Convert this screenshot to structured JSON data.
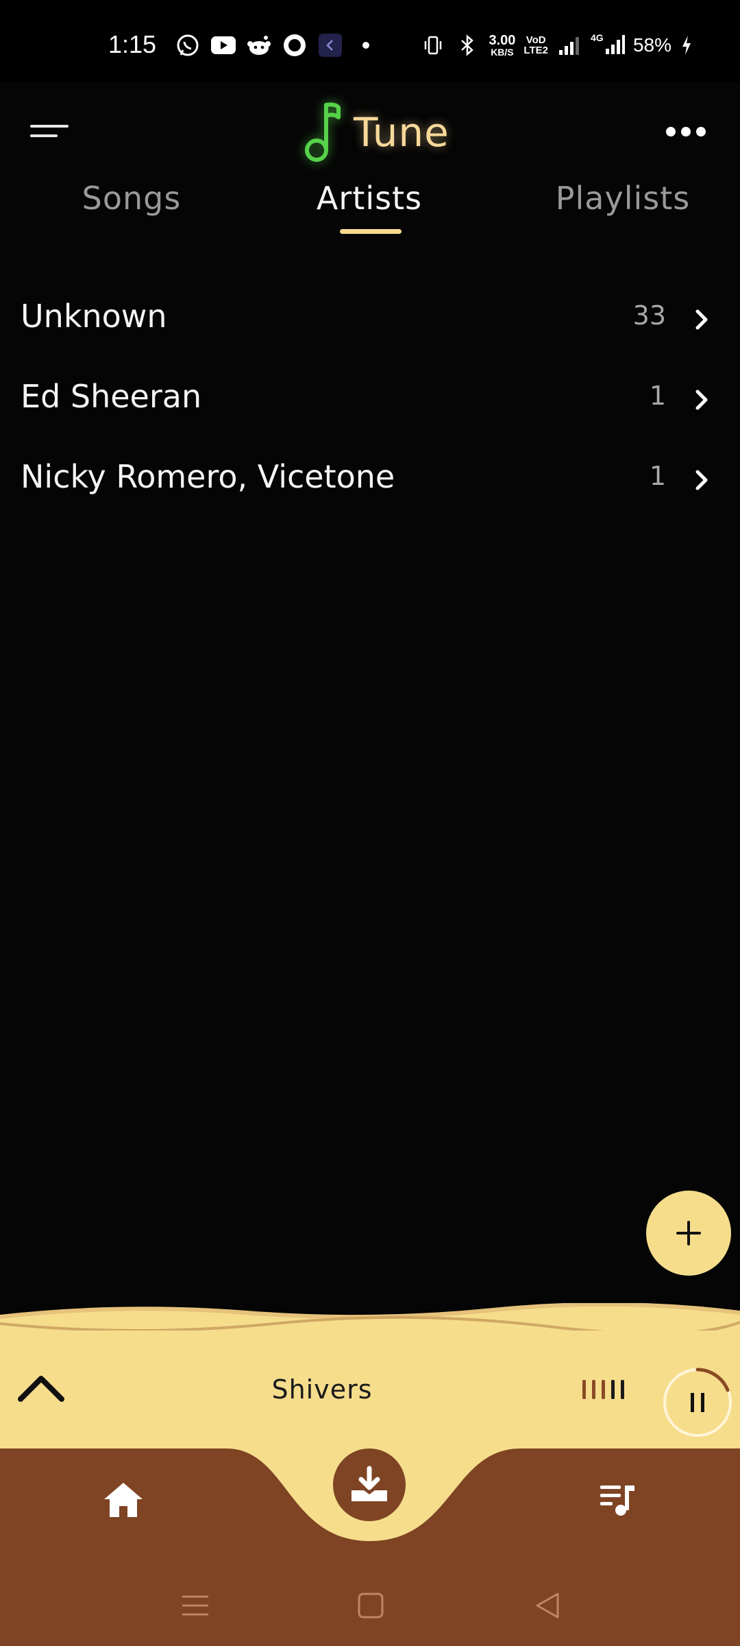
{
  "status_bar": {
    "time": "1:15",
    "net_speed_value": "3.00",
    "net_speed_unit": "KB/S",
    "volte_top": "VoD",
    "volte_bottom": "LTE2",
    "network_label": "4G",
    "battery": "58%",
    "notification_icons": [
      "whatsapp-icon",
      "youtube-icon",
      "reddit-icon",
      "circle-app-icon",
      "back-app-icon",
      "dot-icon"
    ]
  },
  "header": {
    "app_name": "Tune",
    "logo_icon": "music-note-icon",
    "logo_color": "#56d24a",
    "title_color": "#f7d99a"
  },
  "tabs": [
    {
      "label": "Songs",
      "active": false
    },
    {
      "label": "Artists",
      "active": true
    },
    {
      "label": "Playlists",
      "active": false
    }
  ],
  "artists": [
    {
      "name": "Unknown",
      "count": "33"
    },
    {
      "name": "Ed Sheeran",
      "count": "1"
    },
    {
      "name": "Nicky Romero, Vicetone",
      "count": "1"
    }
  ],
  "fab": {
    "icon": "plus-icon"
  },
  "player": {
    "song_title": "Shivers",
    "collapse_icon": "chevron-up-icon",
    "equalizer_icon": "equalizer-icon",
    "pause_icon": "pause-icon",
    "accent": "#f6dd8c"
  },
  "bottom_nav": {
    "home_icon": "home-icon",
    "download_icon": "download-icon",
    "queue_icon": "queue-music-icon",
    "bg": "#7e4424"
  },
  "system_nav": [
    "menu-icon",
    "home-square-icon",
    "back-triangle-icon"
  ]
}
